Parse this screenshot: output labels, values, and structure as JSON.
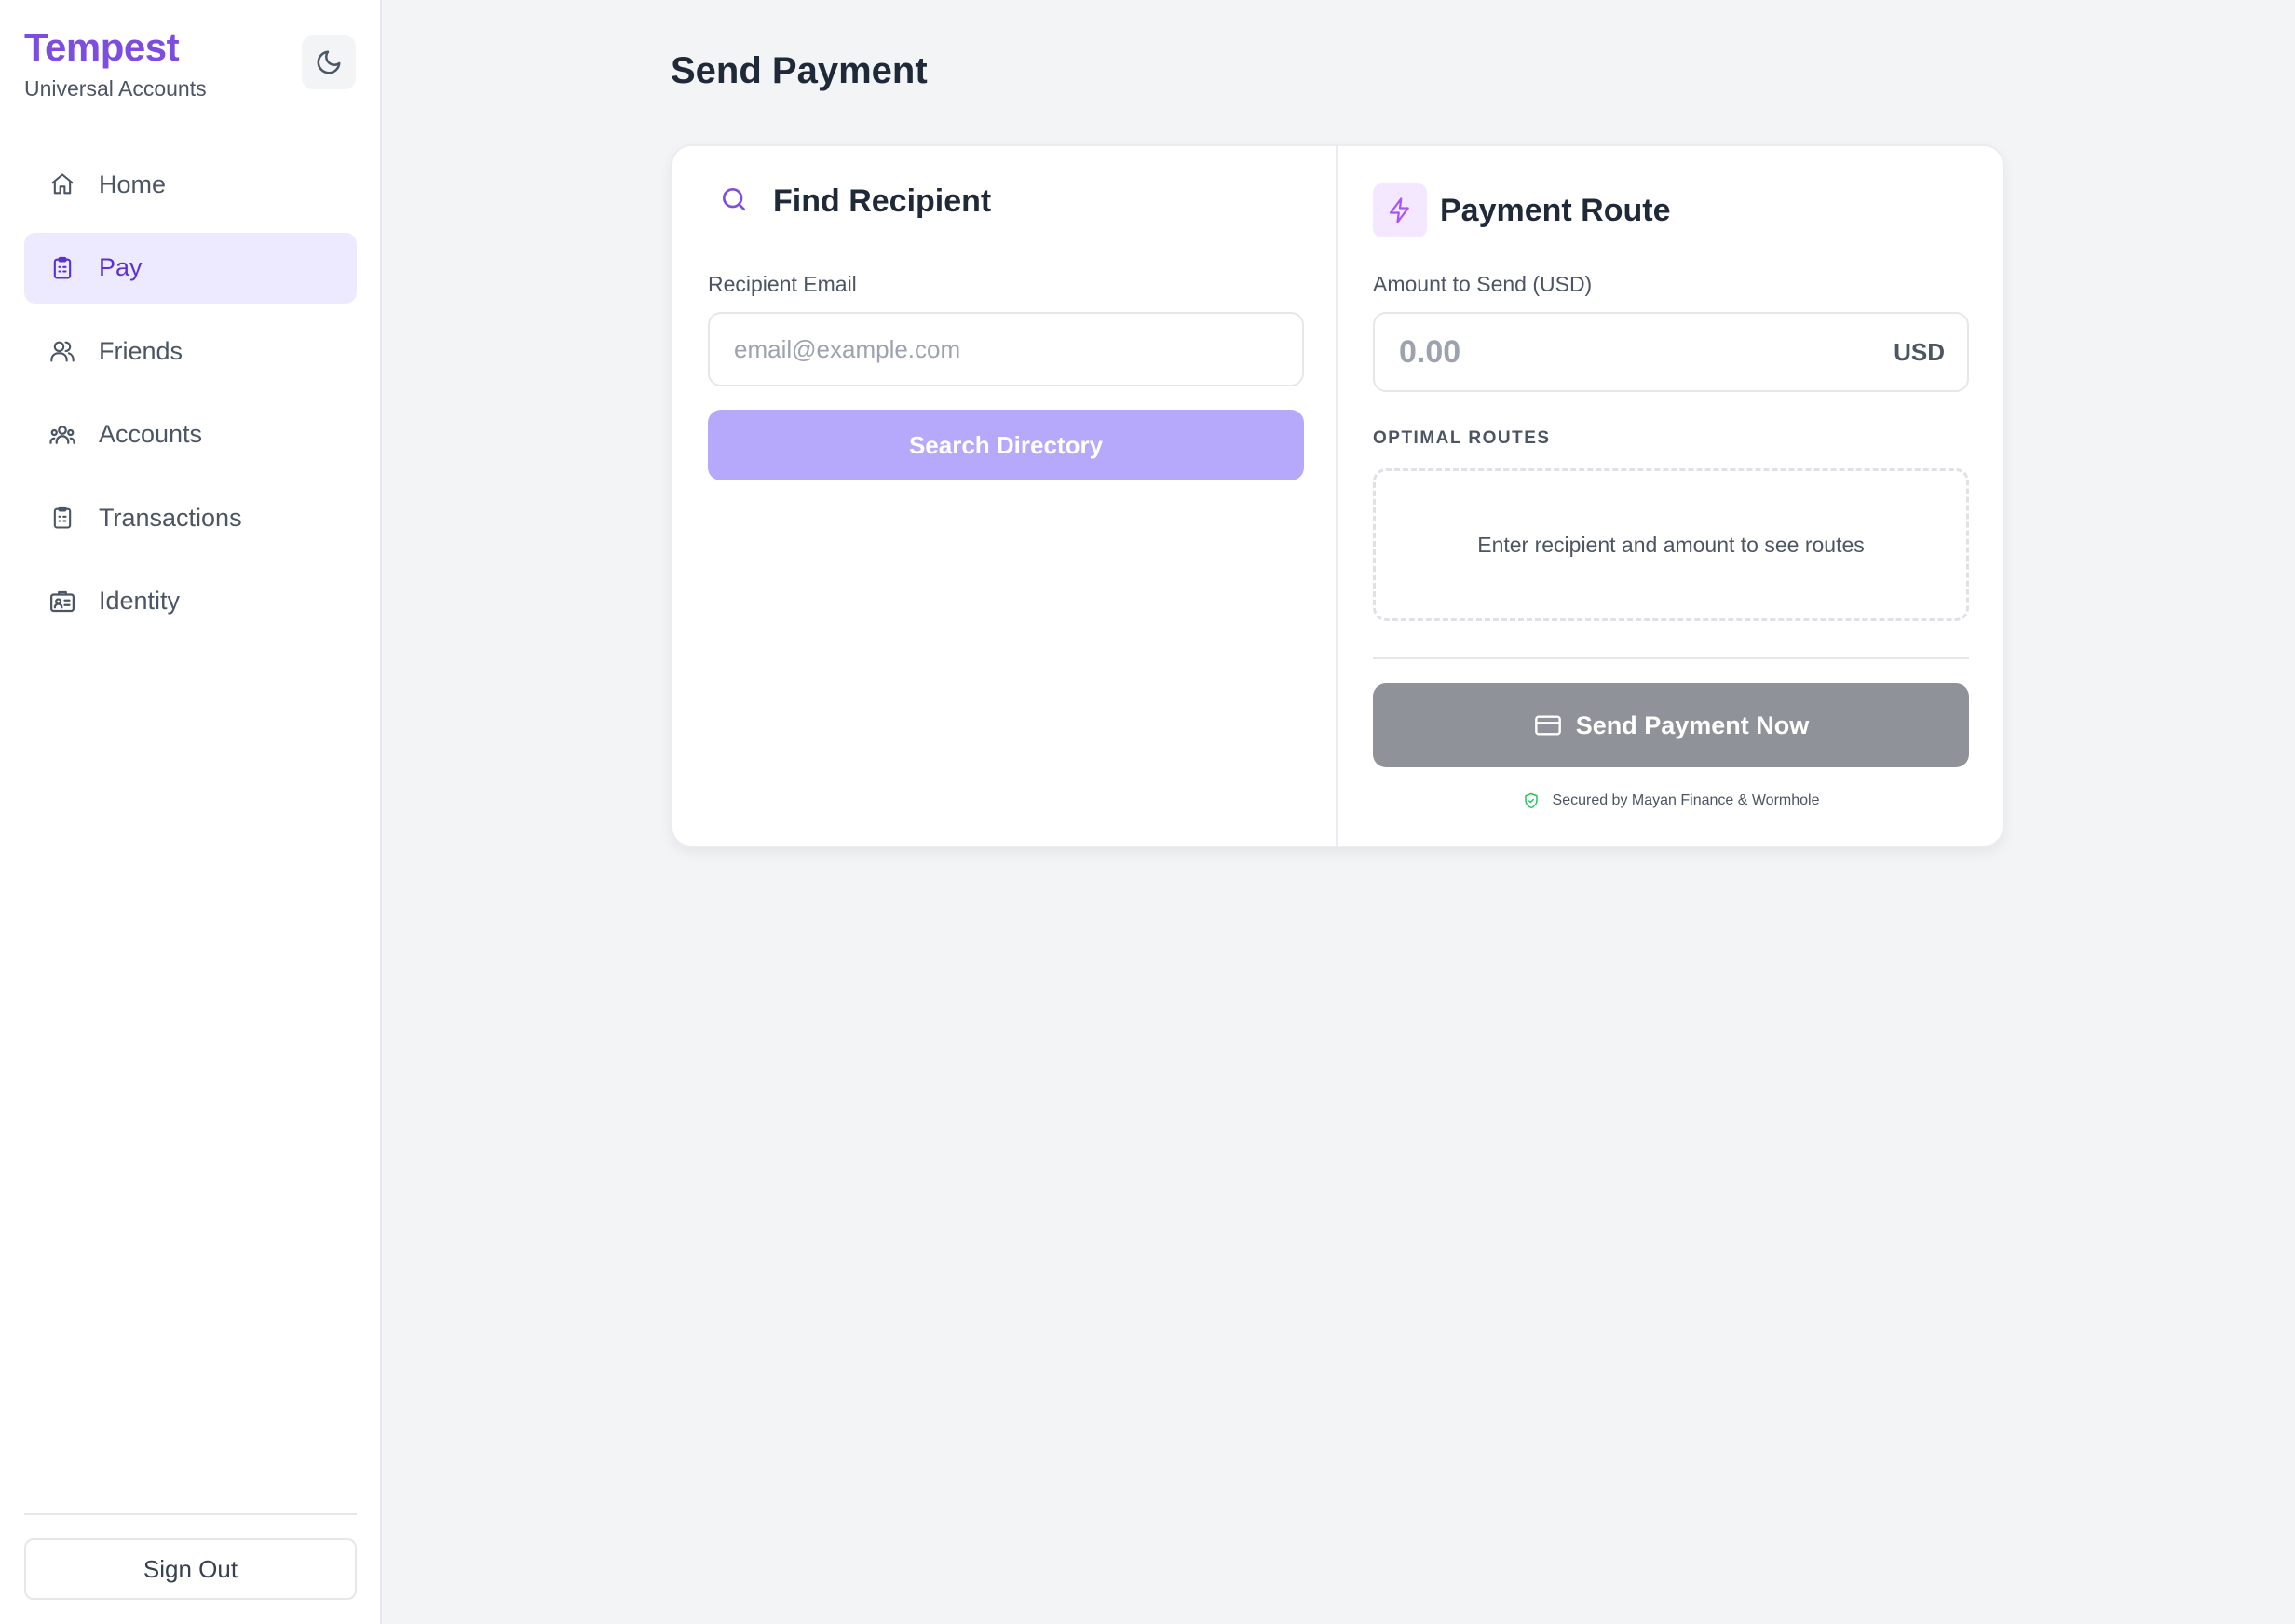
{
  "app": {
    "name": "Tempest",
    "subtitle": "Universal Accounts"
  },
  "sidebar": {
    "items": [
      {
        "label": "Home",
        "icon": "home-icon",
        "active": false
      },
      {
        "label": "Pay",
        "icon": "clipboard-icon",
        "active": true
      },
      {
        "label": "Friends",
        "icon": "users-icon",
        "active": false
      },
      {
        "label": "Accounts",
        "icon": "group-icon",
        "active": false
      },
      {
        "label": "Transactions",
        "icon": "clipboard-list-icon",
        "active": false
      },
      {
        "label": "Identity",
        "icon": "id-card-icon",
        "active": false
      }
    ],
    "sign_out": "Sign Out"
  },
  "page": {
    "title": "Send Payment"
  },
  "find_recipient": {
    "heading": "Find Recipient",
    "email_label": "Recipient Email",
    "email_placeholder": "email@example.com",
    "email_value": "",
    "search_button": "Search Directory"
  },
  "payment_route": {
    "heading": "Payment Route",
    "amount_label": "Amount to Send (USD)",
    "amount_placeholder": "0.00",
    "amount_value": "",
    "currency": "USD",
    "routes_label": "OPTIMAL ROUTES",
    "routes_empty": "Enter recipient and amount to see routes",
    "send_button": "Send Payment Now",
    "secured_text": "Secured by Mayan Finance & Wormhole"
  },
  "colors": {
    "brand": "#7c4ddf",
    "active_nav_bg": "#ede9fe",
    "active_nav_text": "#5b32d0",
    "search_button": "#b6a9fc",
    "send_button_disabled": "#8f9298",
    "secured_icon": "#22c55e"
  }
}
